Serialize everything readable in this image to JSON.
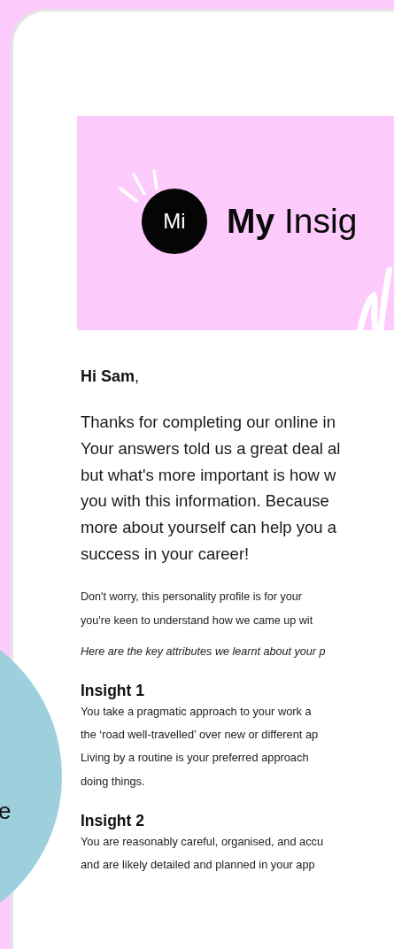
{
  "banner": {
    "logo": "Mi",
    "title": "**My** Insig"
  },
  "greeting": "**Hi Sam**,",
  "intro_lines": [
    "Thanks for completing our online in",
    "Your answers told us a great deal al",
    "but what's more important is how w",
    "you with this information. Because",
    "more about yourself can help you a",
    "success in your career!"
  ],
  "note_lines": [
    "Don't worry, this personality profile is for your",
    "you're keen to understand how we came up wit"
  ],
  "lead_in": "Here are the key attributes we learnt about your p",
  "insights": [
    {
      "heading": "Insight 1",
      "lines": [
        "You take a pragmatic approach to your work a",
        "the ‘road well-travelled’ over new or different ap",
        "Living by a routine is your preferred approach",
        "doing things."
      ]
    },
    {
      "heading": "Insight 2",
      "lines": [
        "You are reasonably careful, organised, and accu",
        "and are likely detailed and planned in your app"
      ]
    }
  ],
  "side_bubble": {
    "text": "e"
  }
}
